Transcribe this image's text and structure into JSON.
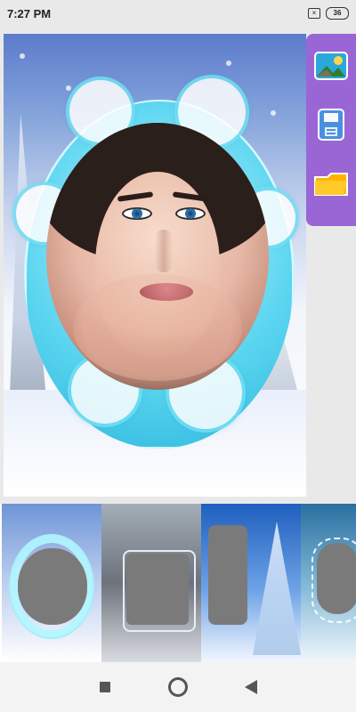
{
  "status": {
    "time": "7:27 PM",
    "battery": "36",
    "icons": [
      "notification-icon",
      "battery-icon"
    ]
  },
  "toolbar": {
    "items": [
      {
        "name": "gallery",
        "icon": "gallery-icon"
      },
      {
        "name": "save",
        "icon": "save-icon"
      },
      {
        "name": "folder",
        "icon": "folder-icon"
      }
    ]
  },
  "thumbnails": {
    "items": [
      {
        "name": "frame-1"
      },
      {
        "name": "frame-2"
      },
      {
        "name": "frame-3"
      },
      {
        "name": "frame-4"
      }
    ]
  },
  "navbar": {
    "buttons": [
      "recents",
      "home",
      "back"
    ]
  },
  "colors": {
    "toolbar": "#9a66d6",
    "frame": "#5ad5f0",
    "thumb_hole": "#7a7a7a"
  }
}
